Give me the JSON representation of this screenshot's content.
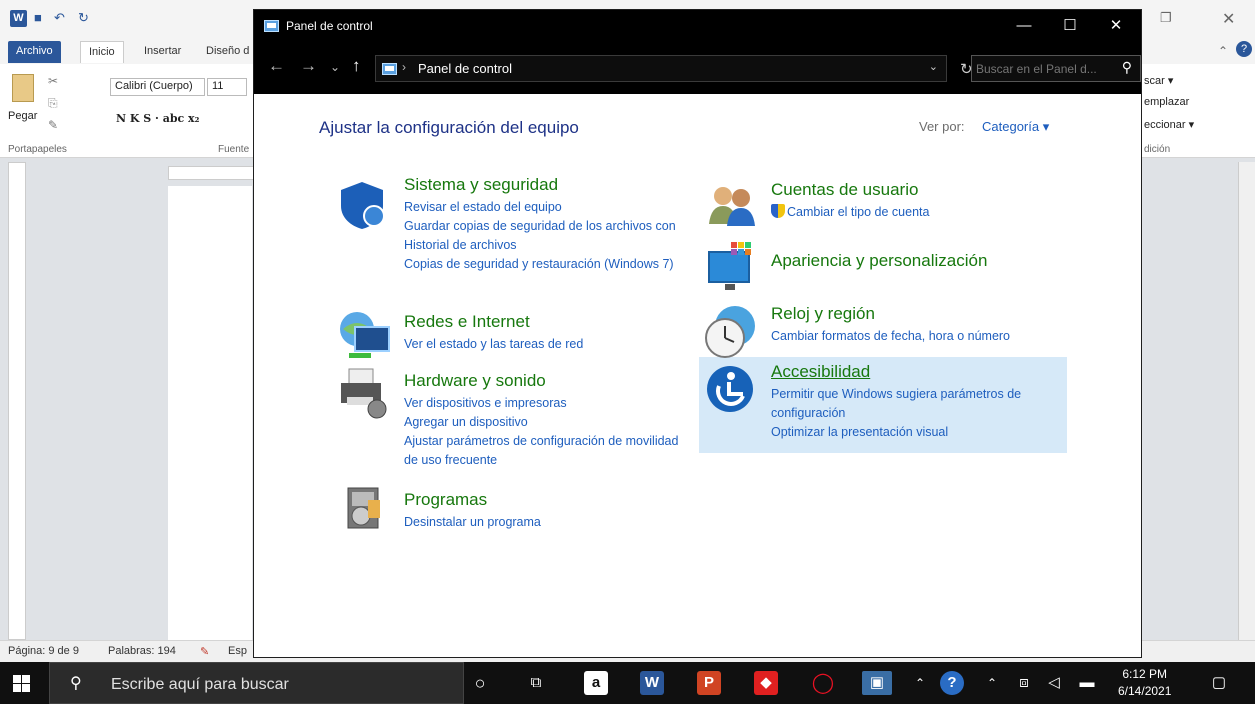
{
  "word": {
    "tabs": [
      "Archivo",
      "Inicio",
      "Insertar",
      "Diseño d"
    ],
    "clipboard": {
      "paste": "Pegar",
      "group": "Portapapeles"
    },
    "font": {
      "name": "Calibri (Cuerpo)",
      "size": "11",
      "group": "Fuente"
    },
    "right_ribbon": [
      "scar ▾",
      "emplazar",
      "eccionar ▾",
      "dición"
    ],
    "status": {
      "page": "Página: 9 de 9",
      "words": "Palabras: 194",
      "lang": "Esp"
    }
  },
  "window": {
    "title": "Panel de control",
    "minimize": "—",
    "maximize": "☐",
    "close": "✕"
  },
  "address": {
    "path": "Panel de control",
    "search_placeholder": "Buscar en el Panel d..."
  },
  "content": {
    "heading": "Ajustar la configuración del equipo",
    "view_by_label": "Ver por:",
    "view_by_value": "Categoría ▾",
    "left": [
      {
        "title": "Sistema y seguridad",
        "links": [
          "Revisar el estado del equipo",
          "Guardar copias de seguridad de los archivos con Historial de archivos",
          "Copias de seguridad y restauración (Windows 7)"
        ]
      },
      {
        "title": "Redes e Internet",
        "links": [
          "Ver el estado y las tareas de red"
        ]
      },
      {
        "title": "Hardware y sonido",
        "links": [
          "Ver dispositivos e impresoras",
          "Agregar un dispositivo",
          "Ajustar parámetros de configuración de movilidad de uso frecuente"
        ]
      },
      {
        "title": "Programas",
        "links": [
          "Desinstalar un programa"
        ]
      }
    ],
    "right": [
      {
        "title": "Cuentas de usuario",
        "links": [
          "Cambiar el tipo de cuenta"
        ]
      },
      {
        "title": "Apariencia y personalización",
        "links": []
      },
      {
        "title": "Reloj y región",
        "links": [
          "Cambiar formatos de fecha, hora o número"
        ]
      },
      {
        "title": "Accesibilidad",
        "links": [
          "Permitir que Windows sugiera parámetros de configuración",
          "Optimizar la presentación visual"
        ]
      }
    ]
  },
  "taskbar": {
    "search_text": "Escribe aquí para buscar",
    "time": "6:12 PM",
    "date": "6/14/2021"
  },
  "colors": {
    "category_title": "#17780e",
    "link": "#1e5ebe",
    "heading": "#1e3287",
    "highlight": "#d6e9f8",
    "titlebar": "#000000"
  },
  "icons": [
    "shield-icon",
    "network-icon",
    "printer-icon",
    "programs-icon",
    "users-icon",
    "appearance-icon",
    "clock-globe-icon",
    "accessibility-icon"
  ]
}
